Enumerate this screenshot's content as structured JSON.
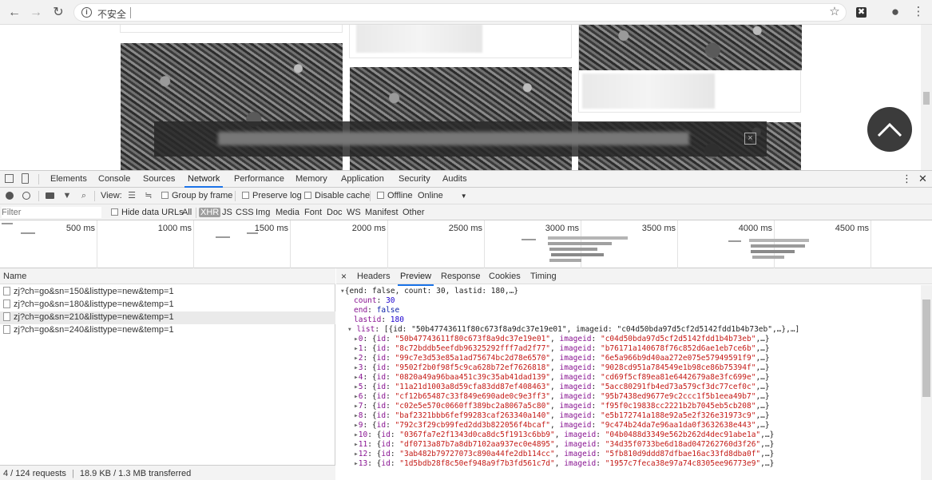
{
  "browser": {
    "security_label": "不安全",
    "nav": {
      "back": "←",
      "forward": "→",
      "reload": "↻"
    },
    "icons": {
      "star": "☆",
      "extension": "✖",
      "profile": "●",
      "menu": "⋮"
    }
  },
  "devtools": {
    "tabs": [
      "Elements",
      "Console",
      "Sources",
      "Network",
      "Performance",
      "Memory",
      "Application",
      "Security",
      "Audits"
    ],
    "active_tab": "Network",
    "toolbar": {
      "view_label": "View:",
      "group_by_frame": "Group by frame",
      "preserve_log": "Preserve log",
      "disable_cache": "Disable cache",
      "offline": "Offline",
      "throttle": "Online"
    },
    "filter": {
      "placeholder": "Filter",
      "hide_data_urls": "Hide data URLs",
      "types": [
        "All",
        "XHR",
        "JS",
        "CSS",
        "Img",
        "Media",
        "Font",
        "Doc",
        "WS",
        "Manifest",
        "Other"
      ],
      "selected_type": "XHR"
    },
    "timeline_ticks": [
      "500 ms",
      "1000 ms",
      "1500 ms",
      "2000 ms",
      "2500 ms",
      "3000 ms",
      "3500 ms",
      "4000 ms",
      "4500 ms"
    ],
    "requests": {
      "column": "Name",
      "rows": [
        "zj?ch=go&sn=150&listtype=new&temp=1",
        "zj?ch=go&sn=180&listtype=new&temp=1",
        "zj?ch=go&sn=210&listtype=new&temp=1",
        "zj?ch=go&sn=240&listtype=new&temp=1"
      ]
    },
    "detail_tabs": [
      "Headers",
      "Preview",
      "Response",
      "Cookies",
      "Timing"
    ],
    "active_detail_tab": "Preview",
    "close_symbol": "×",
    "preview": {
      "summary": "{end: false, count: 30, lastid: 180,…}",
      "count_key": "count",
      "count_value": "30",
      "end_key": "end",
      "end_value": "false",
      "lastid_key": "lastid",
      "lastid_value": "180",
      "list_key": "list",
      "list_summary": "[{id: \"50b47743611f80c673f8a9dc37e19e01\", imageid: \"c04d50bda97d5cf2d5142fdd1b4b73eb\",…},…]",
      "items": [
        {
          "index": "0",
          "id": "\"50b47743611f80c673f8a9dc37e19e01\"",
          "imageid": "\"c04d50bda97d5cf2d5142fdd1b4b73eb\""
        },
        {
          "index": "1",
          "id": "\"8c72bddb5eefdb96325292fff7ad2f77\"",
          "imageid": "\"b76171a140678f76c852d6ae1eb7ce6b\""
        },
        {
          "index": "2",
          "id": "\"99c7e3d53e85a1ad75674bc2d78e6570\"",
          "imageid": "\"6e5a966b9d40aa272e075e57949591f9\""
        },
        {
          "index": "3",
          "id": "\"9502f2b0f98f5c9ca628b72ef7626818\"",
          "imageid": "\"9028cd951a784549e1b98ce86b75394f\""
        },
        {
          "index": "4",
          "id": "\"0820a49a96baa451c39c35ab41dad139\"",
          "imageid": "\"cd69f5cf89ea81e6442679a8e3fc699e\""
        },
        {
          "index": "5",
          "id": "\"11a21d1003a8d59cfa83dd87ef408463\"",
          "imageid": "\"5acc80291fb4ed73a579cf3dc77cef0c\""
        },
        {
          "index": "6",
          "id": "\"cf12b65487c33f849e690ade0c9e3ff3\"",
          "imageid": "\"95b7438ed9677e9c2ccc1f5b1eea49b7\""
        },
        {
          "index": "7",
          "id": "\"c02e5e570c0660ff389bc2a8067a5c80\"",
          "imageid": "\"f95f0c19838cc2221b2b7045eb5cb208\""
        },
        {
          "index": "8",
          "id": "\"baf2321bbb6fef99283caf263340a140\"",
          "imageid": "\"e5b172741a188e92a5e2f326e31973c9\""
        },
        {
          "index": "9",
          "id": "\"792c3f29cb99fed2dd3b822056f4bcaf\"",
          "imageid": "\"9c474b24da7e96aa1da0f3632638e443\""
        },
        {
          "index": "10",
          "id": "\"0367fa7e2f1343d0ca8dc5f1913c6bb9\"",
          "imageid": "\"04b0488d3349e562b262d4dec91abe1a\""
        },
        {
          "index": "11",
          "id": "\"df0713a87b7a8db7102aa937ec0e4895\"",
          "imageid": "\"34d35f0733be6d18ad047262760d3f26\""
        },
        {
          "index": "12",
          "id": "\"3ab482b79727073c890a44fe2db114cc\"",
          "imageid": "\"5fb810d9ddd87dfbae16ac33fd8dba0f\""
        },
        {
          "index": "13",
          "id": "\"1d5bdb28f8c50ef948a9f7b3fd561c7d\"",
          "imageid": "\"1957c7feca38e97a74c8305ee96773e9\""
        }
      ]
    },
    "status": {
      "requests": "4 / 124 requests",
      "transferred": "18.9 KB / 1.3 MB transferred"
    }
  }
}
